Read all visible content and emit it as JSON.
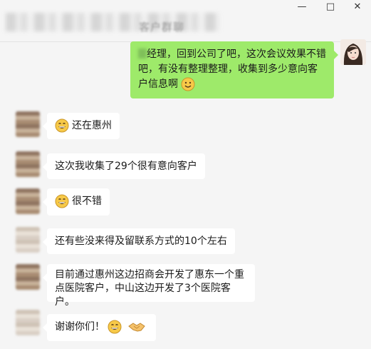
{
  "window": {
    "title": "客户群聊",
    "minimize_label": "—",
    "maximize_label": "□",
    "close_label": "✕"
  },
  "messages": [
    {
      "side": "right",
      "text": "经理，回到公司了吧，这次会议效果不错吧，有没有整理整理，收集到多少意向客户信息啊"
    },
    {
      "side": "left",
      "text": "还在惠州"
    },
    {
      "side": "left",
      "text": "这次我收集了29个很有意向客户"
    },
    {
      "side": "left",
      "text": "很不错"
    },
    {
      "side": "left",
      "text": "还有些没来得及留联系方式的10个左右"
    },
    {
      "side": "left",
      "text": "目前通过惠州这边招商会开发了惠东一个重点医院客户，中山这边开发了3个医院客户。"
    },
    {
      "side": "left",
      "text": "谢谢你们！"
    }
  ],
  "colors": {
    "own_bubble": "#9eea6a",
    "other_bubble": "#ffffff",
    "background": "#f5f5f5"
  },
  "icons": {
    "smile": "smile-emoji-icon",
    "grin": "grin-emoji-icon",
    "handshake": "handshake-emoji-icon"
  }
}
